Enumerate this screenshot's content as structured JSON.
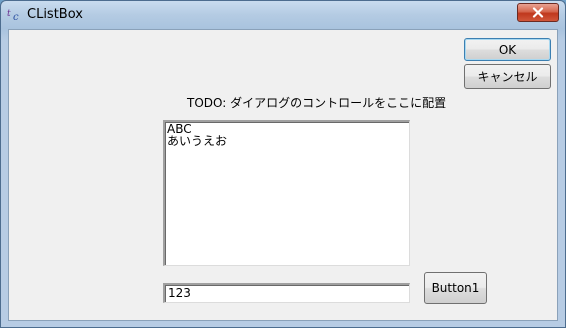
{
  "window": {
    "title": "CListBox",
    "icon": "app-icon"
  },
  "buttons": {
    "ok_label": "OK",
    "cancel_label": "キャンセル",
    "button1_label": "Button1"
  },
  "static": {
    "todo_text": "TODO: ダイアログのコントロールをここに配置"
  },
  "listbox": {
    "items": [
      "ABC",
      "あいうえお"
    ]
  },
  "edit": {
    "value": "123"
  },
  "colors": {
    "close_button": "#c0381d",
    "dialog_background": "#f0f0f0",
    "titlebar": "#b4cbe3"
  }
}
